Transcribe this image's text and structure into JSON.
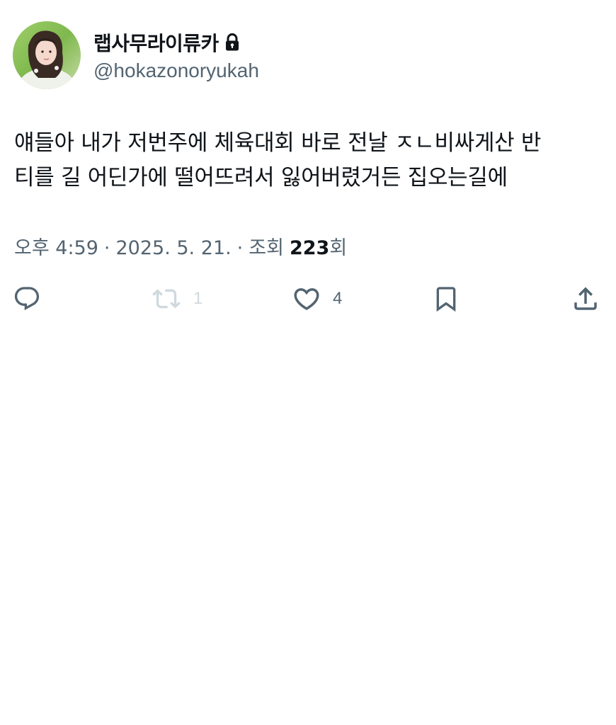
{
  "user": {
    "display_name": "랩사무라이류카",
    "handle": "@hokazonoryukah",
    "avatar_icon": "profile-photo",
    "locked_icon": "lock-icon"
  },
  "tweet": {
    "lines": [
      "얘들아 내가 저번주에 체육대회 바로 전날 ㅈㄴ비싸게산 반",
      "티를 길 어딘가에 떨어뜨려서 잃어버렸거든 집오는길에"
    ]
  },
  "meta": {
    "time": "오후 4:59",
    "dot1": "·",
    "date": "2025. 5. 21.",
    "dot2": "·",
    "views_label": "조회",
    "views_count": "223",
    "views_suffix": "회"
  },
  "actions": {
    "reply": {
      "icon": "reply-icon",
      "count": ""
    },
    "retweet": {
      "icon": "retweet-icon",
      "count": "1"
    },
    "like": {
      "icon": "heart-icon",
      "count": "4"
    },
    "bookmark": {
      "icon": "bookmark-icon",
      "count": ""
    },
    "share": {
      "icon": "share-icon",
      "count": ""
    }
  },
  "colors": {
    "text": "#0f1419",
    "secondary": "#536471",
    "disabled": "#cfd9de",
    "background": "#ffffff"
  }
}
